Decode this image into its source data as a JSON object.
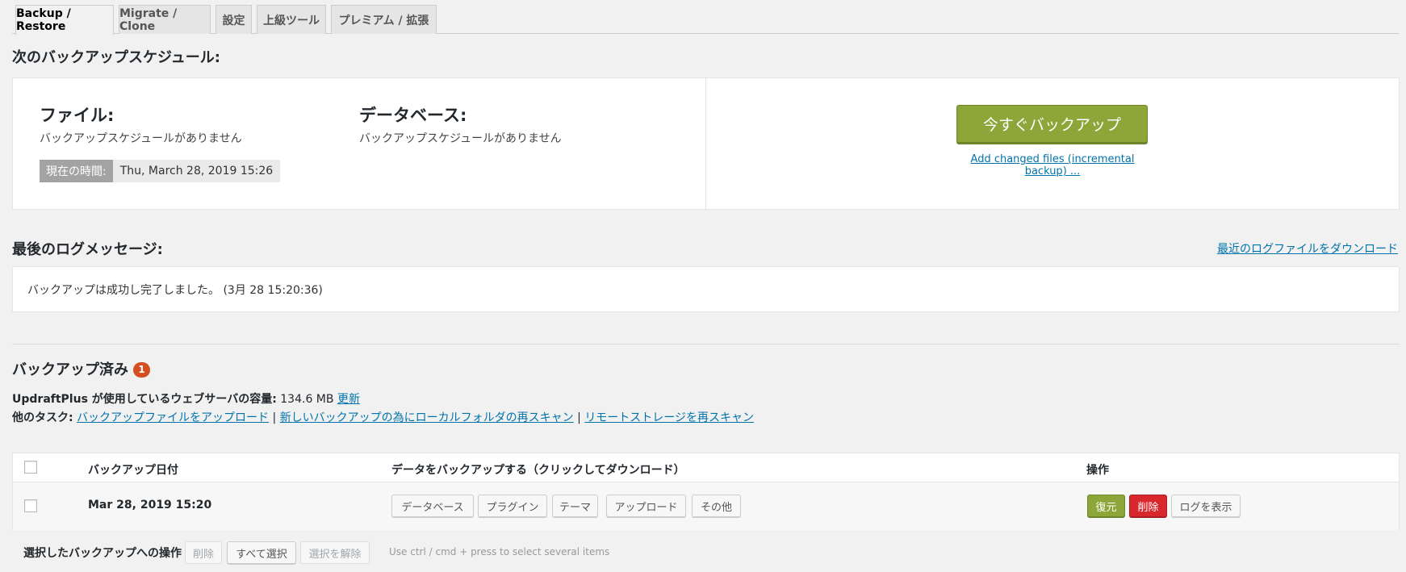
{
  "tabs": [
    {
      "label": "Backup / Restore"
    },
    {
      "label": "Migrate / Clone"
    },
    {
      "label": "設定"
    },
    {
      "label": "上級ツール"
    },
    {
      "label": "プレミアム / 拡張"
    }
  ],
  "schedule": {
    "title": "次のバックアップスケジュール:",
    "files_heading": "ファイル:",
    "files_text": "バックアップスケジュールがありません",
    "db_heading": "データベース:",
    "db_text": "バックアップスケジュールがありません",
    "time_label": "現在の時間:",
    "time_value": "Thu, March 28, 2019 15:26",
    "backup_now": "今すぐバックアップ",
    "incremental_link": "Add changed files (incremental backup) ..."
  },
  "log": {
    "title": "最後のログメッセージ:",
    "download_link": "最近のログファイルをダウンロード",
    "message": "バックアップは成功し完了しました。 (3月 28 15:20:36)"
  },
  "backups": {
    "title": "バックアップ済み",
    "badge_count": "1",
    "usage_label": "UpdraftPlus が使用しているウェブサーバの容量:",
    "usage_value": " 134.6 MB ",
    "refresh_link": "更新",
    "other_tasks_label": "他のタスク:",
    "task_upload": "バックアップファイルをアップロード",
    "task_rescan_local": "新しいバックアップの為にローカルフォルダの再スキャン",
    "task_rescan_remote": "リモートストレージを再スキャン",
    "separator": " | "
  },
  "table": {
    "col_date": "バックアップ日付",
    "col_data": "データをバックアップする（クリックしてダウンロード）",
    "col_actions": "操作",
    "rows": [
      {
        "date": "Mar 28, 2019 15:20",
        "data_buttons": [
          "データベース",
          "プラグイン",
          "テーマ",
          "アップロード",
          "その他"
        ],
        "restore": "復元",
        "delete": "削除",
        "view_log": "ログを表示"
      }
    ]
  },
  "bulk": {
    "label": "選択したバックアップへの操作",
    "delete": "削除",
    "select_all": "すべて選択",
    "deselect": "選択を解除",
    "hint": "Use ctrl / cmd + press to select several items"
  },
  "colors": {
    "accent_green": "#8da639",
    "danger_red": "#d9272e",
    "badge": "#d54e21",
    "link": "#0073aa"
  }
}
